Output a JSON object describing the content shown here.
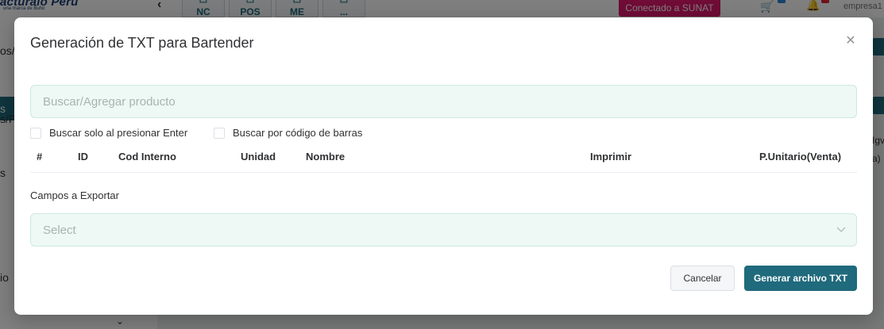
{
  "background": {
    "logo_text": "acturalo Peru",
    "logo_sub": "una marca de Buho",
    "shortcuts": [
      {
        "label": "NC",
        "icon": "receipt-icon"
      },
      {
        "label": "POS",
        "icon": "receipt-icon"
      },
      {
        "label": "ME",
        "icon": "receipt-icon"
      },
      {
        "label": "...",
        "icon": "more-icon"
      }
    ],
    "sunat_badge": "Conectado a SUNAT",
    "user": "empresa1",
    "sidebar_fragments": [
      "os/",
      "s",
      "s/P",
      "s",
      "io"
    ],
    "right_fragments": [
      "Igv",
      "a)"
    ]
  },
  "modal": {
    "title": "Generación de TXT para Bartender",
    "search_placeholder": "Buscar/Agregar producto",
    "checkboxes": [
      {
        "label": "Buscar solo al presionar Enter",
        "checked": false
      },
      {
        "label": "Buscar por código de barras",
        "checked": false
      }
    ],
    "table_headers": [
      "#",
      "ID",
      "Cod Interno",
      "Unidad",
      "Nombre",
      "Imprimir",
      "P.Unitario(Venta)"
    ],
    "export_label": "Campos a Exportar",
    "select_placeholder": "Select",
    "cancel_label": "Cancelar",
    "generate_label": "Generar archivo TXT"
  },
  "colors": {
    "primary": "#1f6a7c",
    "sunat": "#e0196d",
    "input_bg": "#eef8f5"
  }
}
